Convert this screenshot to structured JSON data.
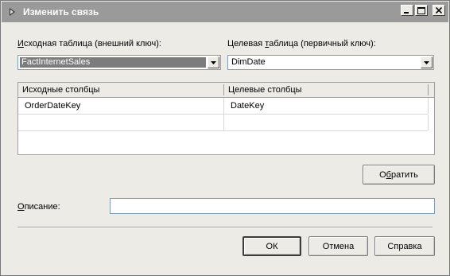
{
  "window": {
    "title": "Изменить связь",
    "icon": "relationship-icon"
  },
  "source": {
    "label_prefix": "И",
    "label_rest": "сходная таблица (внешний ключ):",
    "value": "FactInternetSales"
  },
  "target": {
    "label_pre": "Целевая ",
    "label_underlined": "т",
    "label_post": "аблица (первичный ключ):",
    "value": "DimDate"
  },
  "grid": {
    "headers": [
      "Исходные столбцы",
      "Целевые столбцы"
    ],
    "rows": [
      [
        "OrderDateKey",
        "DateKey"
      ],
      [
        "",
        ""
      ]
    ]
  },
  "reverse_button": {
    "pre": "О",
    "underlined": "б",
    "post": "ратить"
  },
  "description": {
    "label_underlined": "О",
    "label_rest": "писание:",
    "value": ""
  },
  "buttons": {
    "ok": "ОК",
    "cancel": "Отмена",
    "help": "Справка"
  },
  "colors": {
    "titlebar": "#9a9a9a",
    "selection": "#7c7c7c",
    "dialog_bg": "#ecebe6"
  }
}
